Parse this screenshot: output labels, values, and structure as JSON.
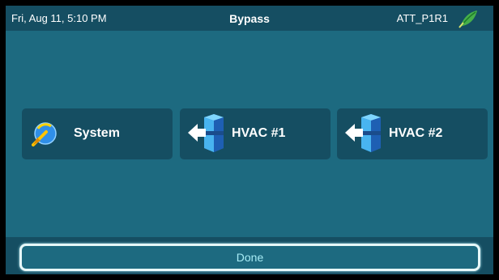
{
  "header": {
    "datetime": "Fri, Aug 11, 5:10 PM",
    "title": "Bypass",
    "device_name": "ATT_P1R1",
    "logo_icon": "leaf-logo-icon"
  },
  "tiles": [
    {
      "label": "System",
      "icon": "system-gauge-icon"
    },
    {
      "label": "HVAC #1",
      "icon": "hvac-unit-arrow-icon"
    },
    {
      "label": "HVAC #2",
      "icon": "hvac-unit-arrow-icon"
    }
  ],
  "footer": {
    "done_label": "Done"
  },
  "colors": {
    "background": "#1d6a80",
    "bar": "#154e62",
    "accent": "#3ec6e6",
    "done_text": "#a8ecf5"
  }
}
